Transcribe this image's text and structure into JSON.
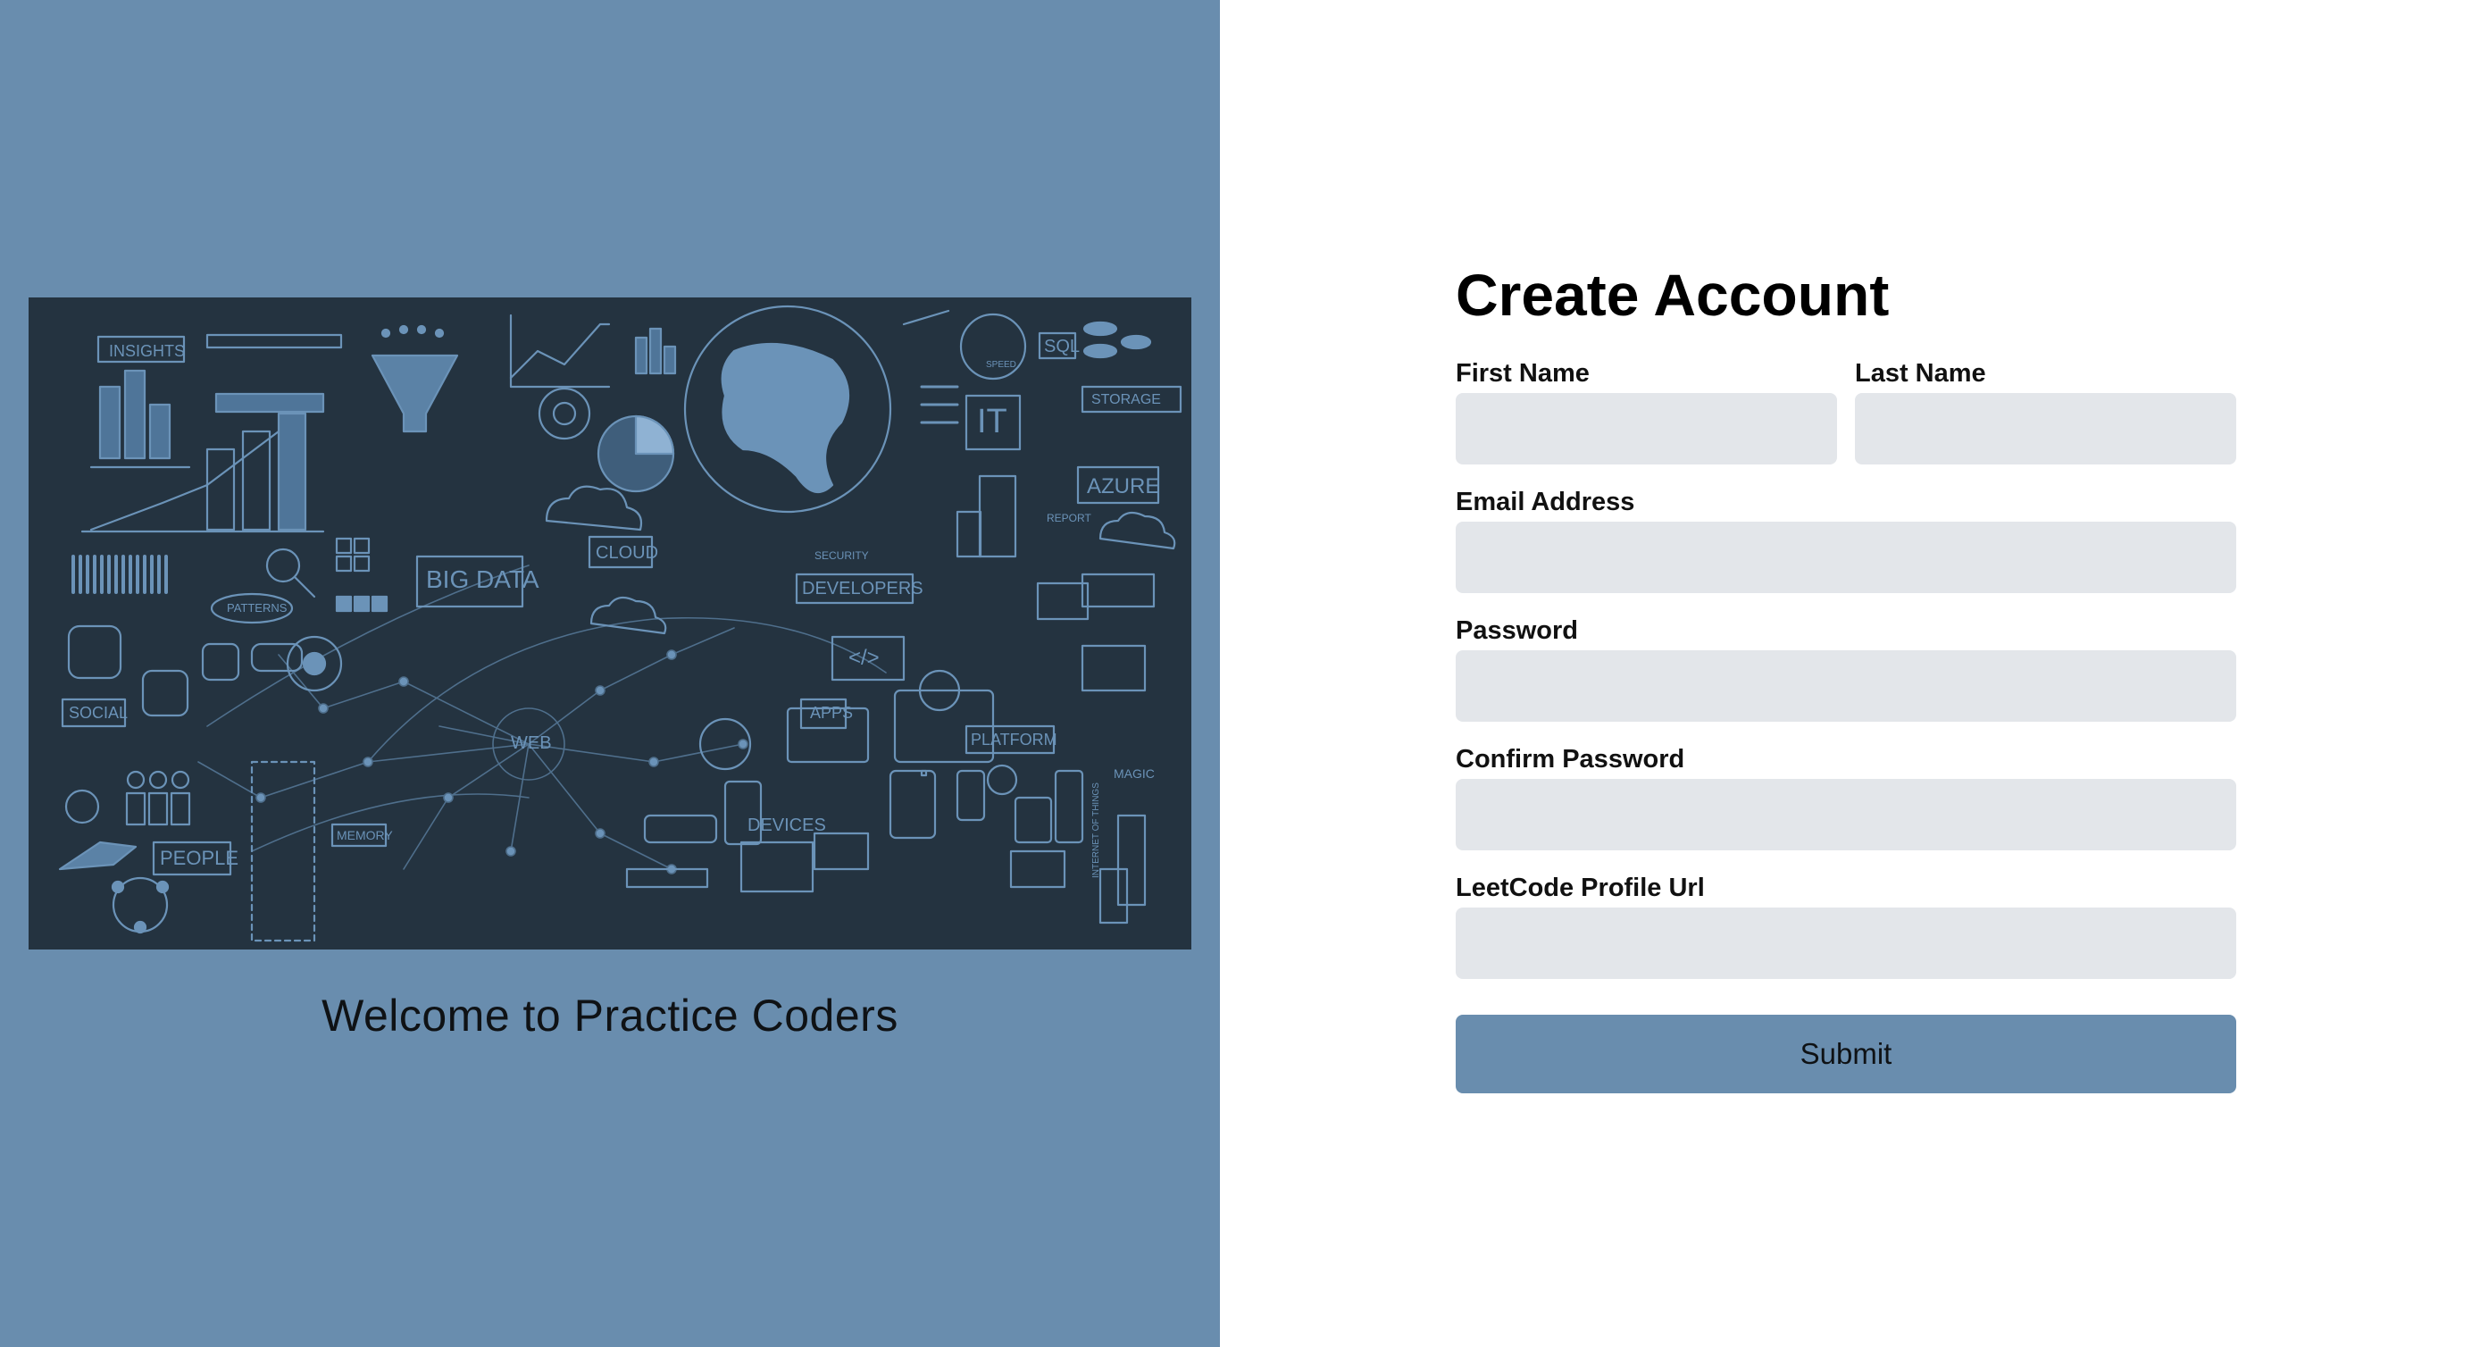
{
  "welcome": {
    "text": "Welcome to Practice Coders"
  },
  "hero": {
    "labels": {
      "insights": "INSIGHTS",
      "big_data": "BIG DATA",
      "cloud": "CLOUD",
      "sql": "SQL",
      "it": "IT",
      "storage": "STORAGE",
      "azure": "AZURE",
      "developers": "DEVELOPERS",
      "security": "SECURITY",
      "patterns": "PATTERNS",
      "social": "SOCIAL",
      "web": "WEB",
      "apps": "APPS",
      "platform": "PLATFORM",
      "devices": "DEVICES",
      "people": "PEOPLE",
      "memory": "MEMORY",
      "magic": "MAGIC",
      "code": "</>",
      "iot": "INTERNET OF THINGS",
      "speed": "SPEED",
      "report": "REPORT"
    }
  },
  "form": {
    "title": "Create Account",
    "first_name": {
      "label": "First Name",
      "value": "",
      "placeholder": ""
    },
    "last_name": {
      "label": "Last Name",
      "value": "",
      "placeholder": ""
    },
    "email": {
      "label": "Email Address",
      "value": "",
      "placeholder": ""
    },
    "password": {
      "label": "Password",
      "value": "",
      "placeholder": ""
    },
    "confirm_password": {
      "label": "Confirm Password",
      "value": "",
      "placeholder": ""
    },
    "leetcode_url": {
      "label": "LeetCode Profile Url",
      "value": "",
      "placeholder": ""
    },
    "submit_label": "Submit"
  },
  "colors": {
    "panel_accent": "#698dae",
    "image_background": "#243340",
    "input_background": "#e3e6ea"
  }
}
